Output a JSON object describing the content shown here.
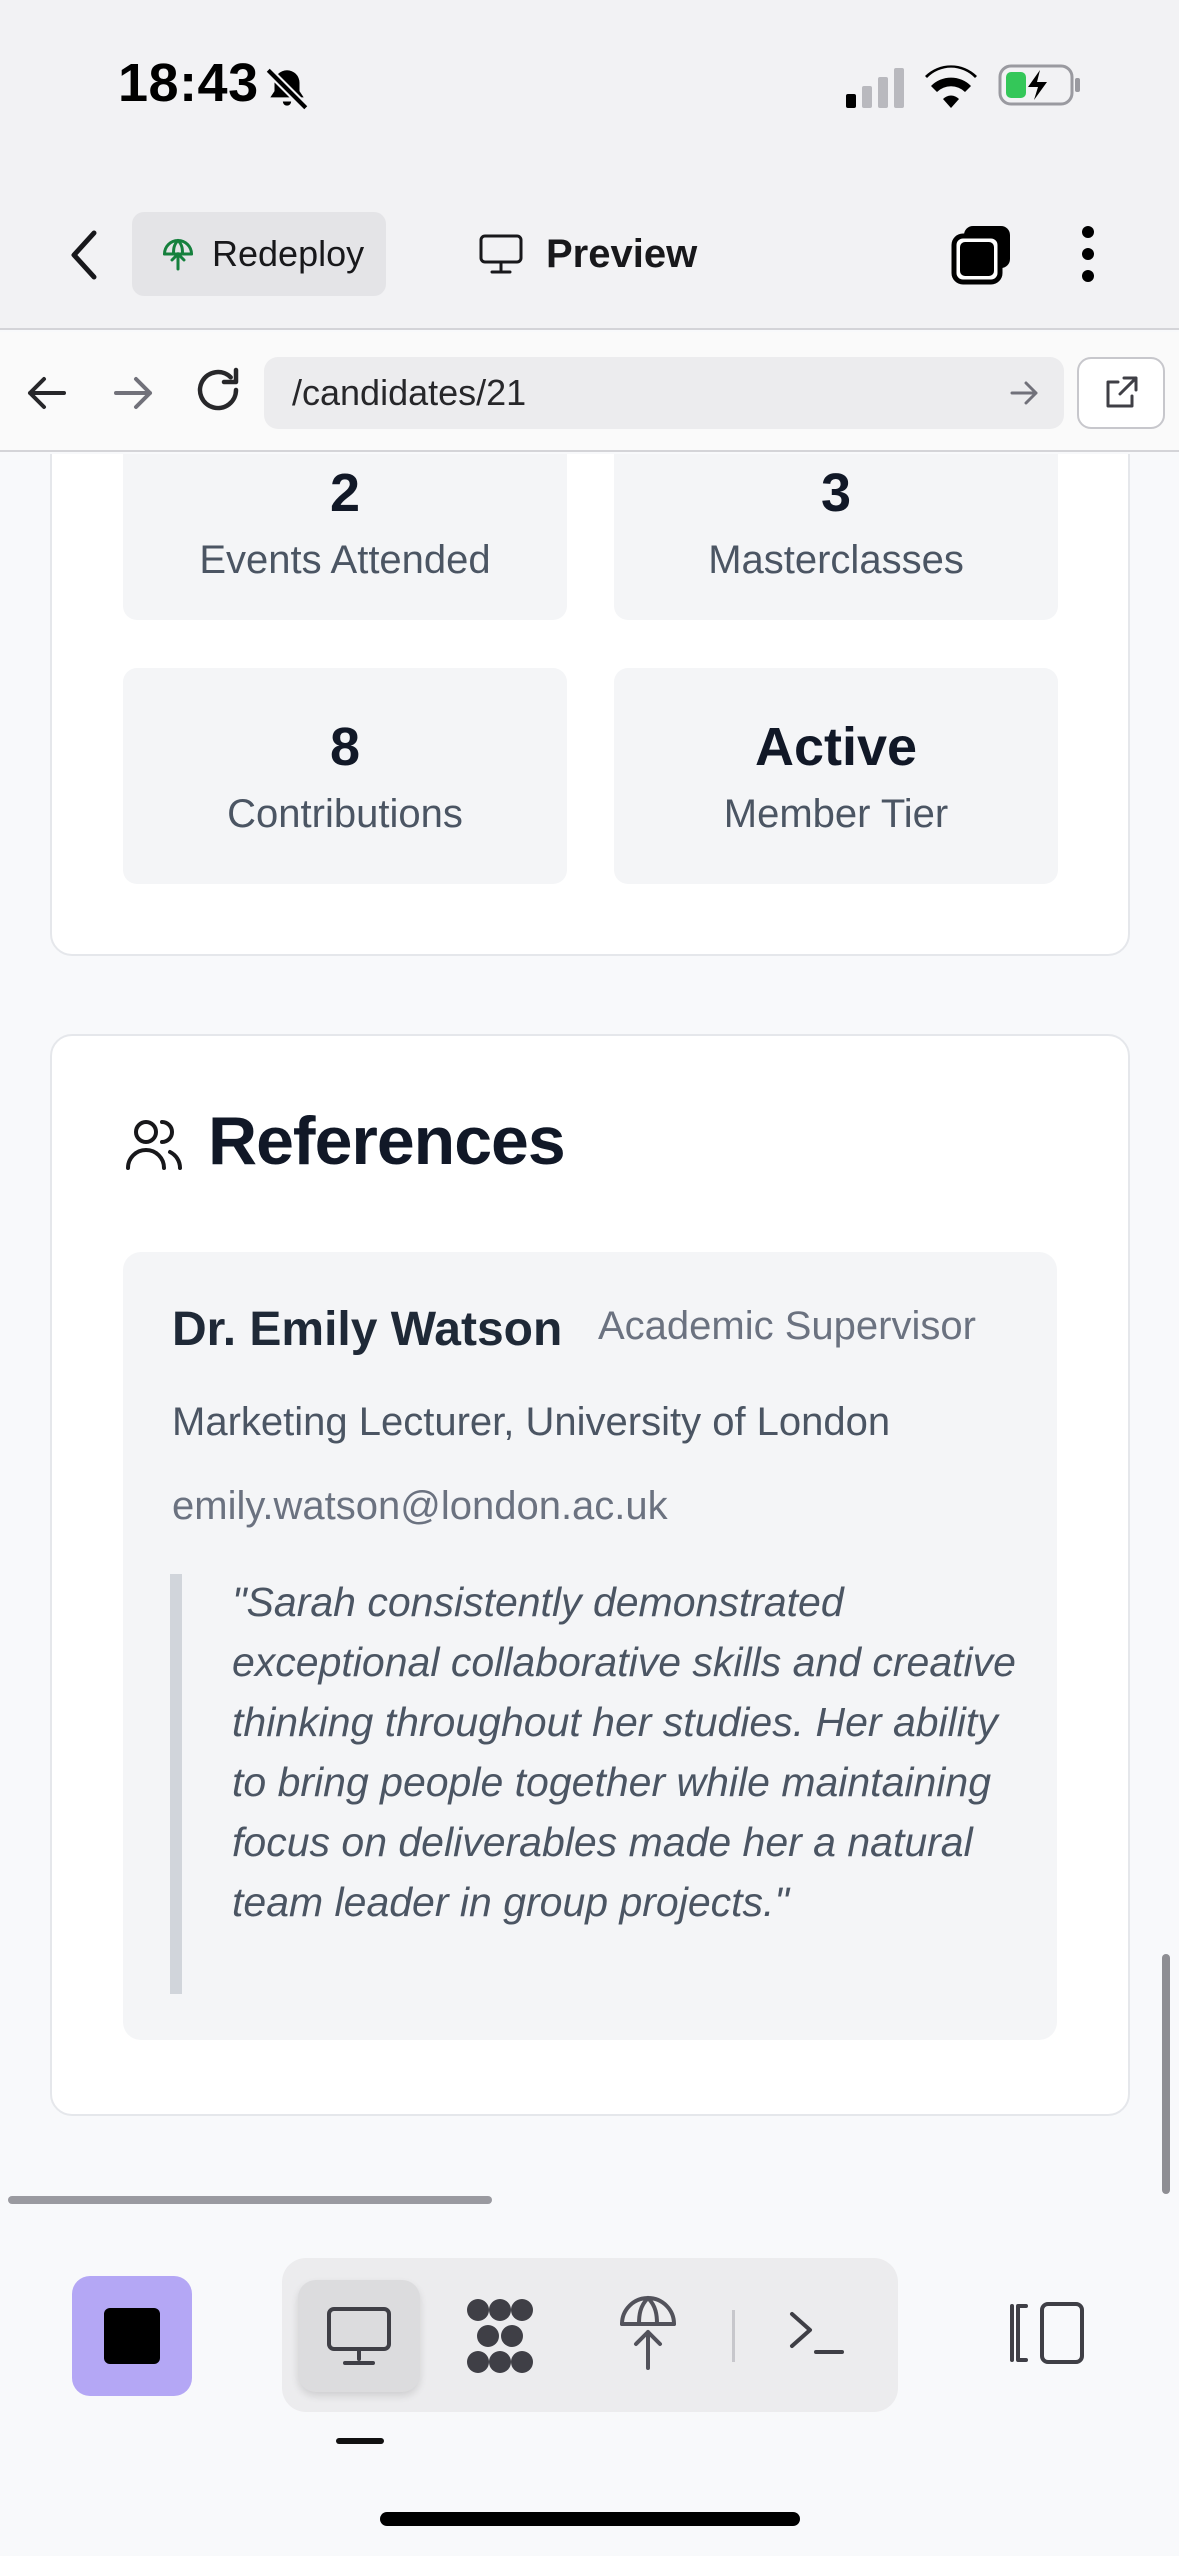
{
  "status_bar": {
    "time": "18:43"
  },
  "toolbar": {
    "redeploy_label": "Redeploy",
    "preview_label": "Preview"
  },
  "browser": {
    "url": "/candidates/21"
  },
  "stats": [
    {
      "value": "2",
      "label": "Events Attended"
    },
    {
      "value": "3",
      "label": "Masterclasses"
    },
    {
      "value": "8",
      "label": "Contributions"
    },
    {
      "value": "Active",
      "label": "Member Tier"
    }
  ],
  "references": {
    "title": "References",
    "items": [
      {
        "name": "Dr. Emily Watson",
        "role": "Academic Supervisor",
        "position": "Marketing Lecturer, University of London",
        "email": "emily.watson@london.ac.uk",
        "quote": "\"Sarah consistently demonstrated exceptional collaborative skills and creative thinking throughout her studies. Her ability to bring people together while maintaining focus on deliverables made her a natural team leader in group projects.\""
      }
    ]
  },
  "colors": {
    "accent": "#b4a7f5",
    "redeploy_icon": "#15803d"
  },
  "icons": {
    "status": [
      "bell-off-icon",
      "signal-icon",
      "wifi-icon",
      "battery-charging-icon"
    ],
    "toolbar": [
      "chevron-left-icon",
      "redeploy-icon",
      "monitor-icon",
      "tabs-icon",
      "more-vertical-icon"
    ],
    "browser": [
      "arrow-left-icon",
      "arrow-right-icon",
      "reload-icon",
      "arrow-right-small-icon",
      "external-link-icon"
    ],
    "dock": [
      "stop-icon",
      "desktop-icon",
      "apps-icon",
      "deploy-icon",
      "terminal-icon",
      "panel-toggle-icon"
    ]
  }
}
